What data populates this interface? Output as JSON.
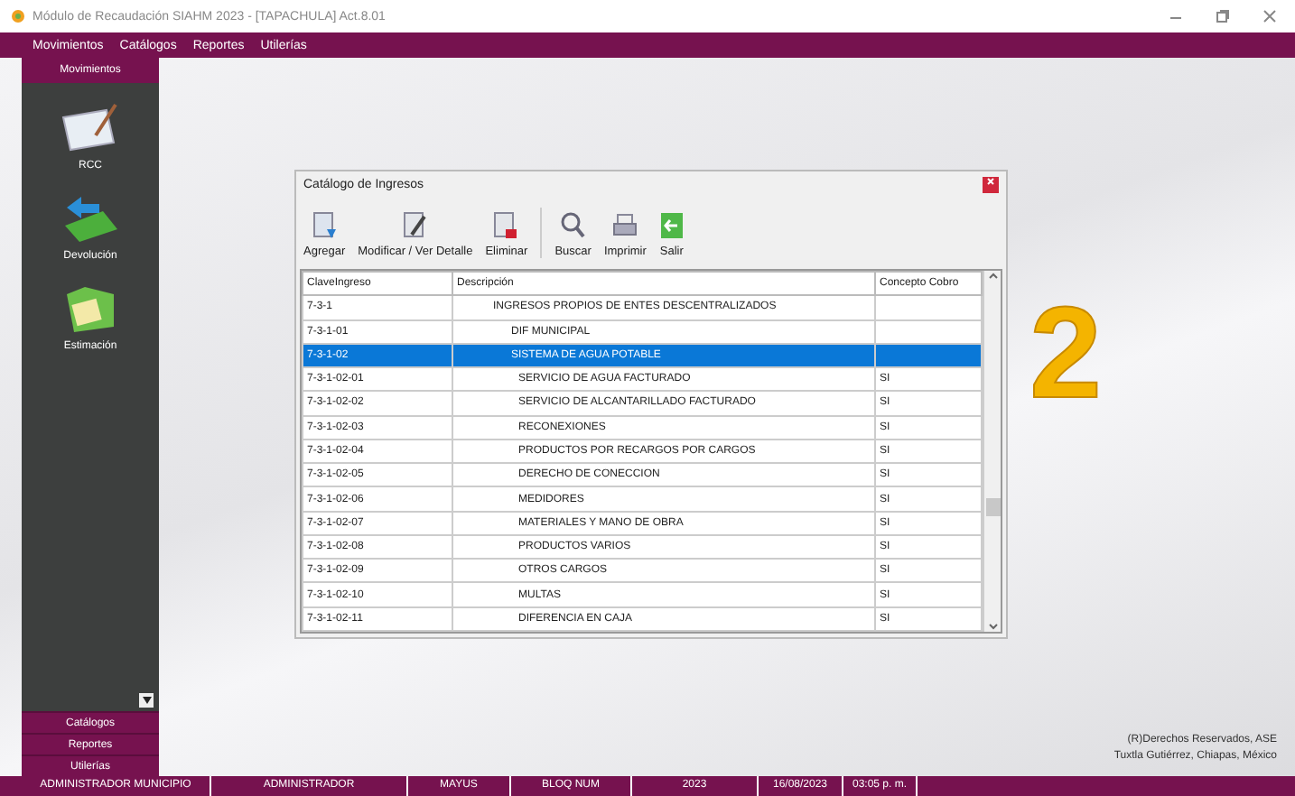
{
  "window": {
    "title": "Módulo de Recaudación SIAHM 2023 - [TAPACHULA] Act.8.01"
  },
  "menu": [
    "Movimientos",
    "Catálogos",
    "Reportes",
    "Utilerías"
  ],
  "sidebar": {
    "header": "Movimientos",
    "items": [
      {
        "label": "RCC",
        "kind": "receipt"
      },
      {
        "label": "Devolución",
        "kind": "refund"
      },
      {
        "label": "Estimación",
        "kind": "folder"
      }
    ],
    "sections": [
      "Catálogos",
      "Reportes",
      "Utilerías"
    ]
  },
  "dialog": {
    "title": "Catálogo de Ingresos",
    "toolbar": [
      {
        "label": "Agregar",
        "kind": "add"
      },
      {
        "label": "Modificar / Ver Detalle",
        "kind": "edit"
      },
      {
        "label": "Eliminar",
        "kind": "delete"
      },
      {
        "label": "Buscar",
        "kind": "search"
      },
      {
        "label": "Imprimir",
        "kind": "print"
      },
      {
        "label": "Salir",
        "kind": "exit"
      }
    ],
    "table": {
      "columns": [
        "ClaveIngreso",
        "Descripción",
        "Concepto Cobro"
      ],
      "rows": [
        {
          "clave": "7-3-1",
          "descripcion": "INGRESOS PROPIOS DE ENTES DESCENTRALIZADOS",
          "selected": false,
          "children": [
            {
              "clave": "7-3-1-01",
              "descripcion": "DIF MUNICIPAL",
              "selected": false
            },
            {
              "clave": "7-3-1-02",
              "descripcion": "SISTEMA DE AGUA POTABLE",
              "selected": true,
              "children": [
                {
                  "clave": "7-3-1-02-01",
                  "descripcion": "SERVICIO DE AGUA FACTURADO",
                  "concepto": "SI",
                  "selected": false
                },
                {
                  "clave": "7-3-1-02-02",
                  "descripcion": "SERVICIO DE ALCANTARILLADO FACTURADO",
                  "concepto": "SI",
                  "selected": false
                },
                {
                  "clave": "7-3-1-02-03",
                  "descripcion": "RECONEXIONES",
                  "concepto": "SI",
                  "selected": false
                },
                {
                  "clave": "7-3-1-02-04",
                  "descripcion": "PRODUCTOS POR RECARGOS POR CARGOS",
                  "concepto": "SI",
                  "selected": false
                },
                {
                  "clave": "7-3-1-02-05",
                  "descripcion": "DERECHO DE CONECCION",
                  "concepto": "SI",
                  "selected": false
                },
                {
                  "clave": "7-3-1-02-06",
                  "descripcion": "MEDIDORES",
                  "concepto": "SI",
                  "selected": false
                },
                {
                  "clave": "7-3-1-02-07",
                  "descripcion": "MATERIALES Y MANO DE OBRA",
                  "concepto": "SI",
                  "selected": false
                },
                {
                  "clave": "7-3-1-02-08",
                  "descripcion": "PRODUCTOS VARIOS",
                  "concepto": "SI",
                  "selected": false
                },
                {
                  "clave": "7-3-1-02-09",
                  "descripcion": "OTROS CARGOS",
                  "concepto": "SI",
                  "selected": false
                },
                {
                  "clave": "7-3-1-02-10",
                  "descripcion": "MULTAS",
                  "concepto": "SI",
                  "selected": false
                },
                {
                  "clave": "7-3-1-02-11",
                  "descripcion": "DIFERENCIA EN CAJA",
                  "concepto": "SI",
                  "selected": false
                }
              ]
            }
          ]
        }
      ]
    }
  },
  "annotation_number": "2",
  "footer": [
    "(R)Derechos Reservados, ASE",
    "Tuxtla Gutiérrez, Chiapas, México"
  ],
  "status_bar": [
    "ADMINISTRADOR MUNICIPIO",
    "ADMINISTRADOR",
    "MAYUS",
    "BLOQ NUM",
    "2023",
    "16/08/2023",
    "03:05 p. m."
  ]
}
